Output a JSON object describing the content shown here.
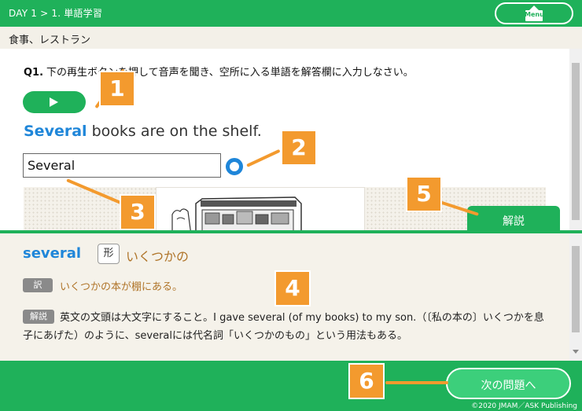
{
  "header": {
    "breadcrumb": "DAY 1 > 1. 単語学習",
    "menu_label": "Menu"
  },
  "subtitle": "食事、レストラン",
  "question": {
    "number": "Q1.",
    "instruction": "下の再生ボタンを押して音声を聞き、空所に入る単語を解答欄に入力しなさい。",
    "sentence_answer": "Several",
    "sentence_rest": " books are on the shelf.",
    "input_value": "Several"
  },
  "explain_tab": "解説",
  "explanation": {
    "word": "several",
    "pos": "形",
    "meaning": "いくつかの",
    "translation_badge": "訳",
    "translation": "いくつかの本が棚にある。",
    "explanation_badge": "解説",
    "explanation_text": "英文の文頭は大文字にすること。I gave several (of my books) to my son.（〔私の本の〕いくつかを息子にあげた）のように、severalには代名詞「いくつかのもの」という用法もある。"
  },
  "footer": {
    "next_label": "次の問題へ",
    "copyright": "©2020 JMAM／ASK Publishing"
  },
  "callouts": [
    "1",
    "2",
    "3",
    "4",
    "5",
    "6"
  ],
  "colors": {
    "brand_green": "#1fb15a",
    "accent_blue": "#1f86d9",
    "callout_orange": "#f39a2e",
    "meaning_brown": "#b0752a"
  }
}
